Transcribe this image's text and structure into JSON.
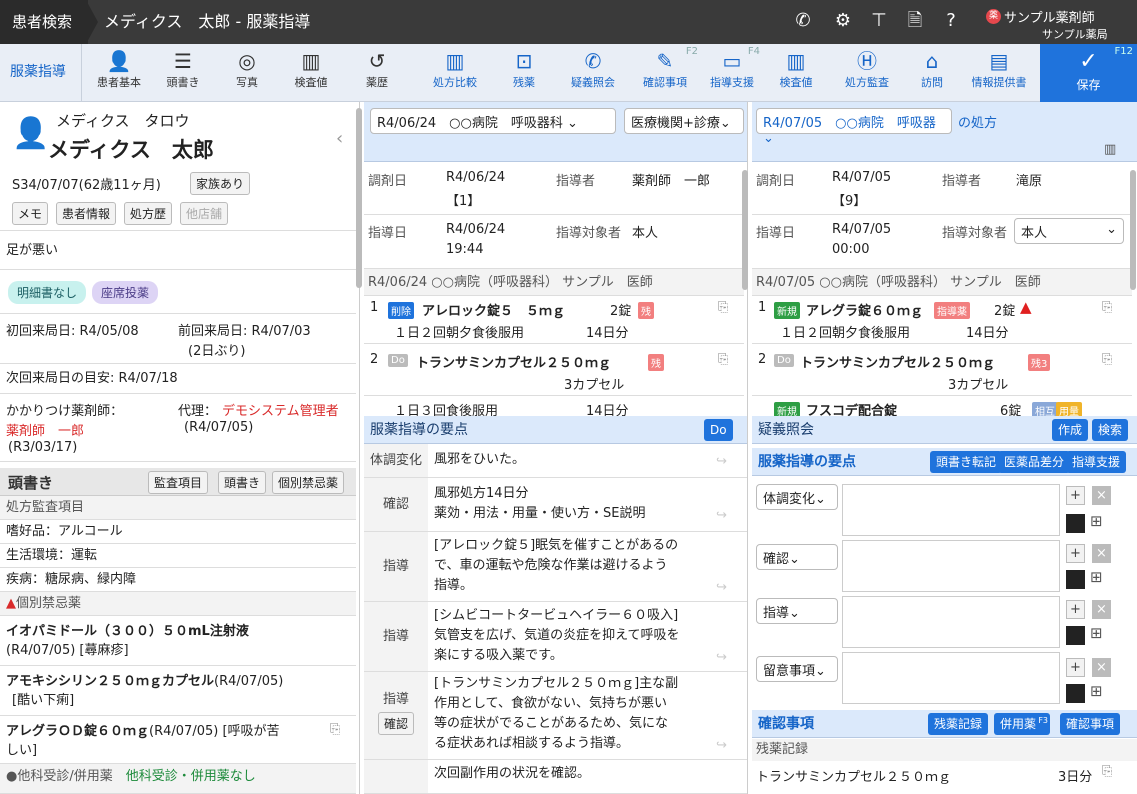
{
  "topbar": {
    "crumb1": "患者検索",
    "crumb2": "メディクス　太郎 - 服薬指導",
    "pharmacist": "サンプル薬剤師",
    "pharmacy": "サンプル薬局",
    "badge": "薬"
  },
  "toolbar": {
    "active": "服薬指導",
    "items": [
      {
        "label": "患者基本",
        "icon": "person-list-icon"
      },
      {
        "label": "頭書き",
        "icon": "checklist-icon"
      },
      {
        "label": "写真",
        "icon": "camera-icon"
      },
      {
        "label": "検査値",
        "icon": "chart-icon"
      },
      {
        "label": "薬歴",
        "icon": "history-icon"
      },
      {
        "label": "処方比較",
        "icon": "columns-icon"
      },
      {
        "label": "残薬",
        "icon": "box-icon"
      },
      {
        "label": "疑義照会",
        "icon": "phone-icon"
      },
      {
        "label": "確認事項",
        "icon": "pen-icon",
        "fkey": "F2"
      },
      {
        "label": "指導支援",
        "icon": "message-icon",
        "fkey": "F4"
      },
      {
        "label": "検査値",
        "icon": "chart-plus-icon"
      },
      {
        "label": "処方監査",
        "icon": "h-icon"
      },
      {
        "label": "訪問",
        "icon": "visit-icon"
      },
      {
        "label": "情報提供書",
        "icon": "document-icon"
      }
    ],
    "save": "保存",
    "save_fkey": "F12"
  },
  "patient": {
    "kana": "メディクス　タロウ",
    "name": "メディクス　太郎",
    "birth": "S34/07/07(62歳11ヶ月)",
    "family": "家族あり",
    "btns": [
      "メモ",
      "患者情報",
      "処方歴",
      "他店舗"
    ],
    "note": "足が悪い",
    "pills": [
      "明細書なし",
      "座席投薬"
    ],
    "first_visit": "初回来局日: R4/05/08",
    "prev_visit": "前回来局日: R4/07/03",
    "prev_gap": "(2日ぶり)",
    "next_visit": "次回来局日の目安: R4/07/18",
    "kakari_label": "かかりつけ薬剤師：",
    "kakari_name": "薬剤師　一郎",
    "kakari_date": "(R3/03/17)",
    "dairi_label": "代理：",
    "dairi_name": "デモシステム管理者",
    "dairi_date": "(R4/07/05)"
  },
  "atamagaki": {
    "title": "頭書き",
    "btns": [
      "監査項目",
      "頭書き",
      "個別禁忌薬"
    ],
    "audit_title": "処方監査項目",
    "items": [
      "嗜好品：アルコール",
      "生活環境：運転",
      "疾病：糖尿病、緑内障"
    ],
    "kinki_title": "個別禁忌薬",
    "kinki": [
      {
        "name": "イオパミドール（３００）５０mL注射液",
        "detail": "(R4/07/05)  [蕁麻疹]"
      },
      {
        "name": "アモキシシリン２５０ｍｇカプセル",
        "detail": "(R4/07/05)",
        "detail2": "[酷い下痢]"
      },
      {
        "name": "アレグラＯＤ錠６０ｍｇ",
        "detail": "(R4/07/05)  [呼吸が苦",
        "detail2": "しい]"
      }
    ],
    "other_label": "●他科受診/併用薬",
    "other_value": "他科受診・併用薬なし"
  },
  "mid": {
    "date_sel": "R4/06/24　○○病院　呼吸器科",
    "type_sel": "医療機関+診療",
    "chozai_label": "調剤日",
    "chozai": "R4/06/24",
    "chozai_no": "【1】",
    "shidosha_label": "指導者",
    "shidosha": "薬剤師　一郎",
    "shido_label": "指導日",
    "shido": "R4/06/24",
    "shido_time": "19:44",
    "taisho_label": "指導対象者",
    "taisho": "本人",
    "rx_header": "R4/06/24 ○○病院（呼吸器科） サンプル　医師",
    "rx": [
      {
        "no": "1",
        "tag": "削除",
        "drug": "アレロック錠５　５ｍｇ",
        "qty": "2錠",
        "zan": "残",
        "usage": "１日２回朝夕食後服用",
        "days": "14日分"
      },
      {
        "no": "2",
        "tag": "Do",
        "drug": "トランサミンカプセル２５０ｍｇ",
        "qty": "3カプセル",
        "zan": "残",
        "usage": "１日３回食後服用",
        "days": "14日分"
      }
    ],
    "points_title": "服薬指導の要点",
    "do_btn": "Do",
    "points": [
      {
        "label": "体調変化",
        "text": [
          "風邪をひいた。"
        ]
      },
      {
        "label": "確認",
        "text": [
          "風邪処方14日分",
          "薬効・用法・用量・使い方・SE説明"
        ]
      },
      {
        "label": "指導",
        "text": [
          "[アレロック錠５]眠気を催すことがあるの",
          "で、車の運転や危険な作業は避けるよう",
          "指導。"
        ]
      },
      {
        "label": "指導",
        "text": [
          "[シムビコートタービュヘイラー６０吸入]",
          "気管支を広げ、気道の炎症を抑えて呼吸を",
          "楽にする吸入薬です。"
        ]
      },
      {
        "label": "指導",
        "btn": "確認",
        "text": [
          "[トランサミンカプセル２５０ｍｇ]主な副",
          "作用として、食欲がない、気持ちが悪い",
          "等の症状がでることがあるため、気にな",
          "る症状あれば相談するよう指導。"
        ]
      },
      {
        "label": "",
        "text": [
          "次回副作用の状況を確認。"
        ]
      }
    ]
  },
  "right": {
    "date_sel": "R4/07/05　○○病院　呼吸器",
    "suffix": "の処方",
    "chozai_label": "調剤日",
    "chozai": "R4/07/05",
    "chozai_no": "【9】",
    "shidosha_label": "指導者",
    "shidosha": "滝原",
    "shido_label": "指導日",
    "shido": "R4/07/05",
    "shido_time": "00:00",
    "taisho_label": "指導対象者",
    "taisho": "本人",
    "rx_header": "R4/07/05 ○○病院（呼吸器科） サンプル　医師",
    "rx": [
      {
        "no": "1",
        "tag": "新規",
        "drug": "アレグラ錠６０ｍｇ",
        "badge": "指導薬",
        "qty": "2錠",
        "usage": "１日２回朝夕食後服用",
        "days": "14日分"
      },
      {
        "no": "2",
        "tag": "Do",
        "drug": "トランサミンカプセル２５０ｍｇ",
        "zan": "残3",
        "qty": "3カプセル"
      },
      {
        "no": "",
        "tag": "新規",
        "drug": "フスコデ配合錠",
        "qty": "6錠",
        "t1": "相互",
        "t2": "用量"
      }
    ],
    "gigi_title": "疑義照会",
    "gigi_btns": [
      "作成",
      "検索"
    ],
    "points_title": "服薬指導の要点",
    "points_btns": [
      "頭書き転記",
      "医薬品差分",
      "指導支援"
    ],
    "point_types": [
      "体調変化",
      "確認",
      "指導",
      "留意事項"
    ],
    "kakunin_title": "確認事項",
    "kakunin_btns": [
      "残薬記録",
      "併用薬",
      "確認事項"
    ],
    "kakunin_fkey": "F3",
    "zan_label": "残薬記録",
    "zan_drug": "トランサミンカプセル２５０ｍｇ",
    "zan_days": "3日分"
  }
}
